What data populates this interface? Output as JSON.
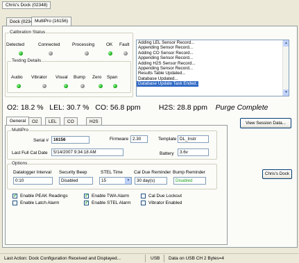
{
  "window": {
    "title": "Chris's Dock (02348)"
  },
  "outer_tabs": [
    {
      "label": "Dock (02348)"
    },
    {
      "label": "MultiPro (16156)"
    }
  ],
  "calibration": {
    "group_label": "Calibration Status",
    "status_labels": [
      "Detected",
      "Connected",
      "Processing",
      "OK",
      "Fault"
    ],
    "status_leds": [
      "green",
      "gray",
      "gray",
      "green",
      "gray"
    ],
    "testing": {
      "group_label": "Testing Details",
      "labels": [
        "Audio",
        "Vibrator",
        "Visual",
        "Bump",
        "Zero",
        "Span"
      ],
      "leds": [
        "green",
        "gray",
        "green",
        "gray",
        "green",
        "green"
      ]
    }
  },
  "log": [
    "Adding LEL Sensor Record...",
    "Appending Sensor Record...",
    "Adding CO Sensor Record...",
    "Appending Sensor Record...",
    "Adding H2S Sensor Record...",
    "Appending Sensor Record...",
    "Results Table Updated...",
    "Database Updated...",
    "Database Update Task Ended."
  ],
  "readings": {
    "o2": "O2: 18.2 %",
    "lel": "LEL: 30.7 %",
    "co": "CO: 56.8 ppm",
    "h2s": "H2S: 28.8 ppm",
    "status": "Purge Complete"
  },
  "inner_tabs": [
    {
      "label": "General"
    },
    {
      "label": "O2"
    },
    {
      "label": "LEL"
    },
    {
      "label": "CO"
    },
    {
      "label": "H2S"
    }
  ],
  "buttons": {
    "view_session": "View Session Data...",
    "dock": "Chris's Dock"
  },
  "multipro": {
    "group_label": "MultiPro",
    "serial_label": "Serial #",
    "serial_value": "16156",
    "firmware_label": "Firmware",
    "firmware_value": "2.30",
    "template_label": "Template",
    "template_value": "DL_Instr",
    "last_cal_label": "Last Full Cal Date",
    "last_cal_value": "5/14/2007 9:34:18 AM",
    "battery_label": "Battery",
    "battery_value": "3.6v"
  },
  "options": {
    "group_label": "Options",
    "datalogger_label": "Datalogger Interval",
    "datalogger_value": "0:10",
    "security_label": "Security Beep",
    "security_value": "Disabled",
    "stel_label": "STEL Time",
    "stel_value": "15",
    "cal_due_label": "Cal Due Reminder",
    "cal_due_value": "30 day(s)",
    "bump_label": "Bump Reminder",
    "bump_value": "Disabled"
  },
  "checkboxes": [
    {
      "label": "Enable PEAK Readings",
      "checked": true
    },
    {
      "label": "Enable TWA Alarm",
      "checked": true
    },
    {
      "label": "Cal Due Lockout",
      "checked": false
    },
    {
      "label": "Enable Latch Alarm",
      "checked": false
    },
    {
      "label": "Enable STEL Alarm",
      "checked": true
    },
    {
      "label": "Vibrator Enabled",
      "checked": false
    }
  ],
  "statusbar": {
    "last_action": "Last Action: Dock Configuration Received and Displayed...",
    "port": "USB",
    "data": "Data on USB CH 2 Bytes=4"
  },
  "colors": {
    "led_green": "#15b015",
    "led_gray": "#8a8a8a",
    "disabled_text": "#21a121",
    "selection": "#316ac5"
  }
}
